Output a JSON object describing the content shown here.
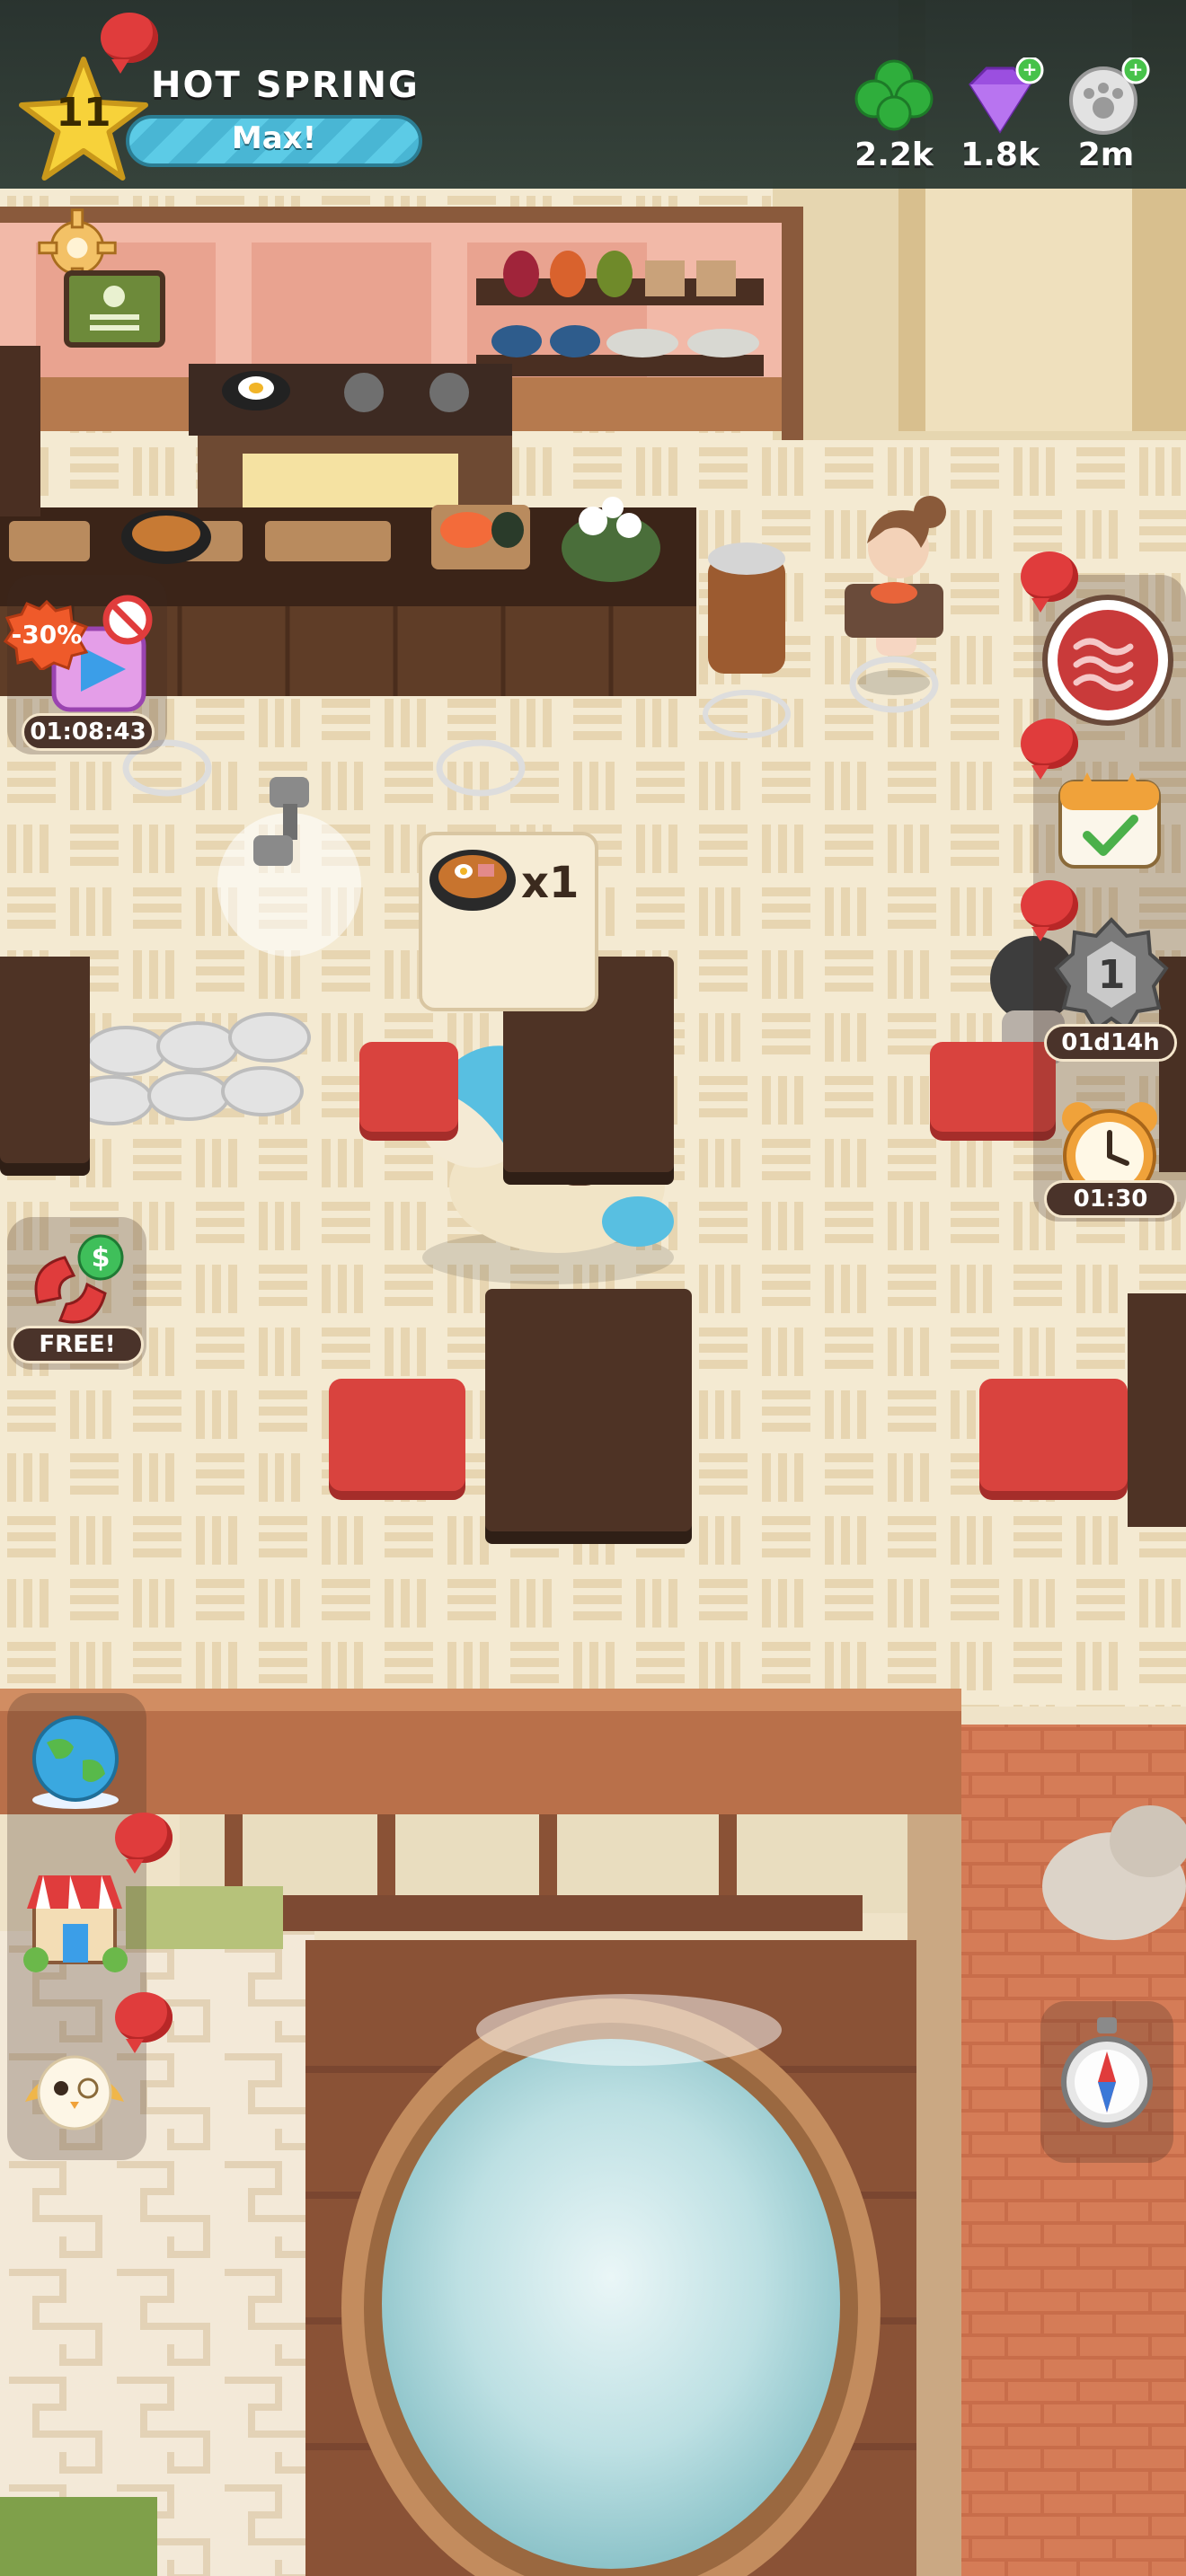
{
  "hud": {
    "level": "11",
    "area_title": "HOT SPRING",
    "progress_label": "Max!",
    "currencies": [
      {
        "name": "clover",
        "icon": "clover-icon",
        "value": "2.2k",
        "color": "#2fae3c"
      },
      {
        "name": "gem",
        "icon": "gem-icon",
        "value": "1.8k",
        "color": "#9b4fe0"
      },
      {
        "name": "paw-coin",
        "icon": "paw-coin-icon",
        "value": "2m",
        "color": "#d8d8d8"
      }
    ]
  },
  "left_panel": {
    "sale_badge": "-30%",
    "sale_timer": "01:08:43",
    "magnet_label": "FREE!"
  },
  "right_panel": {
    "badge_level": "1",
    "badge_timer": "01d14h",
    "clock_timer": "01:30"
  },
  "order": {
    "quantity": "x1"
  }
}
